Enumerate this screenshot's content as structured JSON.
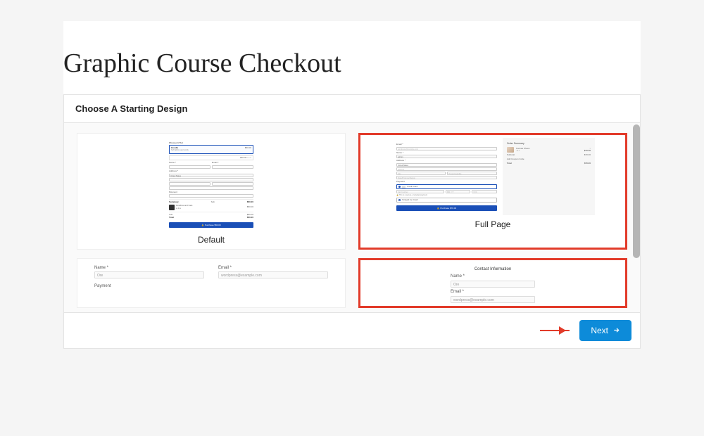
{
  "page_title": "Graphic Course Checkout",
  "panel_title": "Choose A Starting Design",
  "designs": {
    "default": {
      "label": "Default",
      "thumb": {
        "choose_tier": "Choose A Tier",
        "tier_name": "Hoodie",
        "tier_sub": "Soft fabrics and comfy",
        "tier_price": "$50.00",
        "tier2_price": "$60.00",
        "fields": {
          "name": "Name *",
          "email": "Email *",
          "address": "Address *",
          "country": "United States",
          "payment": "Payment",
          "summary": "Summary"
        },
        "line_item": {
          "name": "Hoodies and hats",
          "qty": "1",
          "price": "$50.00"
        },
        "subtotal": {
          "label": "Sub",
          "value": "$50.00"
        },
        "sub_label": "Sub",
        "fifty": "$50.00",
        "total": {
          "label": "Total",
          "value": "$50.00"
        },
        "button": "Purchase $50.00"
      }
    },
    "full_page": {
      "label": "Full Page",
      "selected": true,
      "thumb": {
        "fields": {
          "email": "Email *",
          "email_placeholder": "wordpress@example.com",
          "name": "Name *",
          "name_value": "self-on",
          "address": "Address *",
          "country": "United States",
          "address_ph": "Address",
          "city_ph": "City",
          "postal_ph": "Postal Code/Zip",
          "state_ph": "State/Province/Region",
          "payment": "Payment",
          "credit_card": "Credit Card",
          "card_num_ph": "Card number",
          "exp_ph": "MM / YY",
          "cvc_ph": "CVC",
          "cash_option": "Straight Up Cash",
          "button": "Purchase $70.00"
        },
        "summary": {
          "title": "Order Summary",
          "item_name": "Canvas Shoes",
          "item_qty_controls": "- 1 +",
          "item_price": "$70.00",
          "subtotal_label": "Subtotal",
          "subtotal": "$70.00",
          "coupon_label": "Add Coupon Code",
          "total_label": "Total",
          "total": "$70.00"
        }
      }
    }
  },
  "row2": {
    "left": {
      "name_label": "Name *",
      "name_value": "Ore",
      "email_label": "Email *",
      "email_value": "wordpress@example.com",
      "payment_label": "Payment"
    },
    "right": {
      "title": "Contact Information",
      "name_label": "Name *",
      "name_value": "Ore",
      "email_label": "Email *",
      "email_value": "wordpress@example.com"
    }
  },
  "footer": {
    "next": "Next"
  }
}
